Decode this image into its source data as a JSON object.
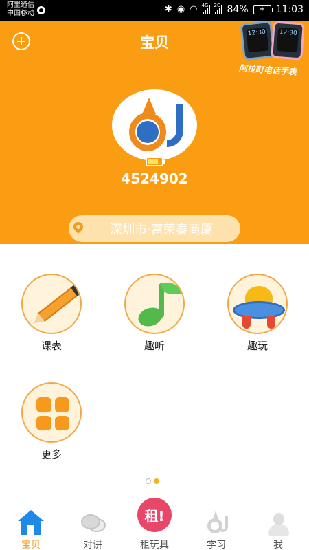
{
  "status_bar": {
    "carrier_line1": "阿里通信",
    "carrier_line2": "中国移动",
    "signal1_tag": "4G",
    "signal2_tag": "2G",
    "battery_percent": "84%",
    "time": "11:03"
  },
  "header": {
    "title": "宝贝",
    "promo_text": "阿拉町电话手表",
    "promo_watch_text": "12:30"
  },
  "device": {
    "id": "4524902",
    "battery_level": 0.8
  },
  "location": {
    "text": "深圳市·富荣泰商厦"
  },
  "functions": [
    {
      "label": "课表",
      "icon": "pencil-icon"
    },
    {
      "label": "趣听",
      "icon": "music-note-icon"
    },
    {
      "label": "趣玩",
      "icon": "ufo-icon"
    },
    {
      "label": "更多",
      "icon": "grid-icon"
    }
  ],
  "pager": {
    "pages": 2,
    "active_page": 2
  },
  "bottom_nav": {
    "items": [
      {
        "label": "宝贝",
        "icon": "home-icon"
      },
      {
        "label": "对讲",
        "icon": "chat-icon"
      },
      {
        "label": "租玩具",
        "icon": "rent-icon",
        "badge": "租!"
      },
      {
        "label": "学习",
        "icon": "logo-drop-icon"
      },
      {
        "label": "我",
        "icon": "person-icon"
      }
    ],
    "active_index": 0
  },
  "colors": {
    "accent": "#fb9d13",
    "nav_active": "#1e8ae6",
    "rent_badge": "#e8476a"
  }
}
